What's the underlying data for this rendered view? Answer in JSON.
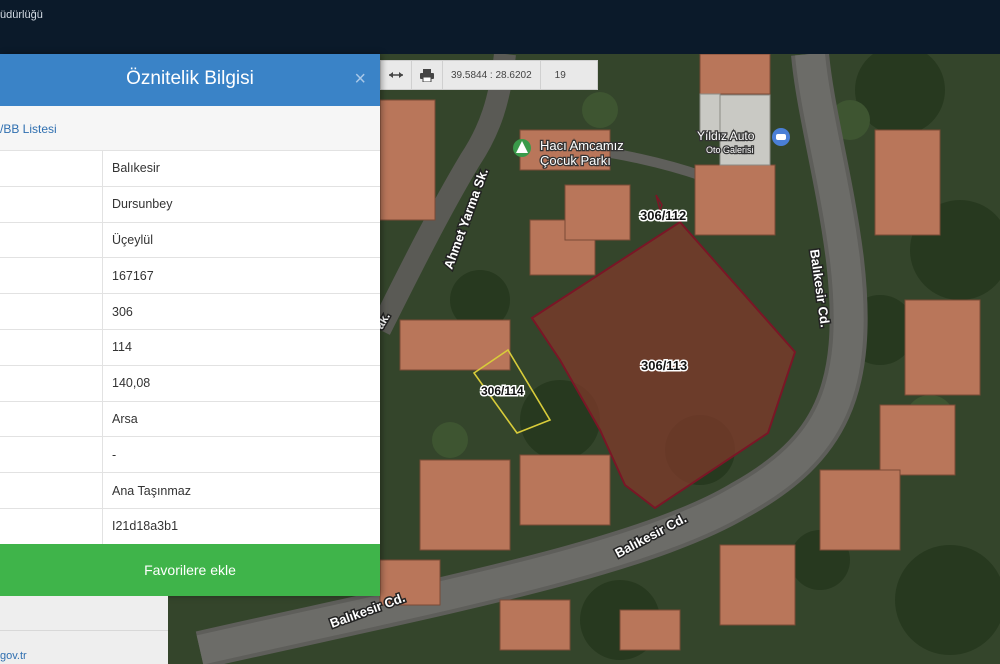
{
  "header": {
    "title": "üdürlüğü"
  },
  "map_toolbar": {
    "coords": "39.5844 : 28.6202",
    "zoom": "19",
    "icons": [
      "arrows-horizontal-icon",
      "printer-icon"
    ]
  },
  "panel": {
    "title": "Öznitelik Bilgisi",
    "close": "×",
    "link_label": "/BB Listesi",
    "values": [
      "Balıkesir",
      "Dursunbey",
      "Üçeylül",
      "167167",
      "306",
      "114",
      "140,08",
      "Arsa",
      "-",
      "Ana Taşınmaz",
      "I21d18a3b1"
    ],
    "favorite_button": "Favorilere ekle"
  },
  "footer": {
    "link": "gov.tr"
  },
  "map_labels": {
    "road_1": "Ahmet Yarma Sk.",
    "road_2": "Balıkesir Cd.",
    "road_3": "Balıkesir Cd.",
    "road_4": "Balıkesir Cd.",
    "road_fragment": "ak.",
    "parcel_a": "306/112",
    "parcel_b": "306/113",
    "parcel_c": "306/114",
    "poi_park_line1": "Hacı Amcamız",
    "poi_park_line2": "Çocuk Parkı",
    "poi_auto_line1": "Yıldız Auto",
    "poi_auto_line2": "Oto Galerisi"
  },
  "colors": {
    "header_bg": "#0b1a2a",
    "panel_header": "#3a83c7",
    "favorite_button": "#3fb44a",
    "parcel_selected": "#7a1626",
    "parcel_neighbor": "#d8cc3a"
  }
}
